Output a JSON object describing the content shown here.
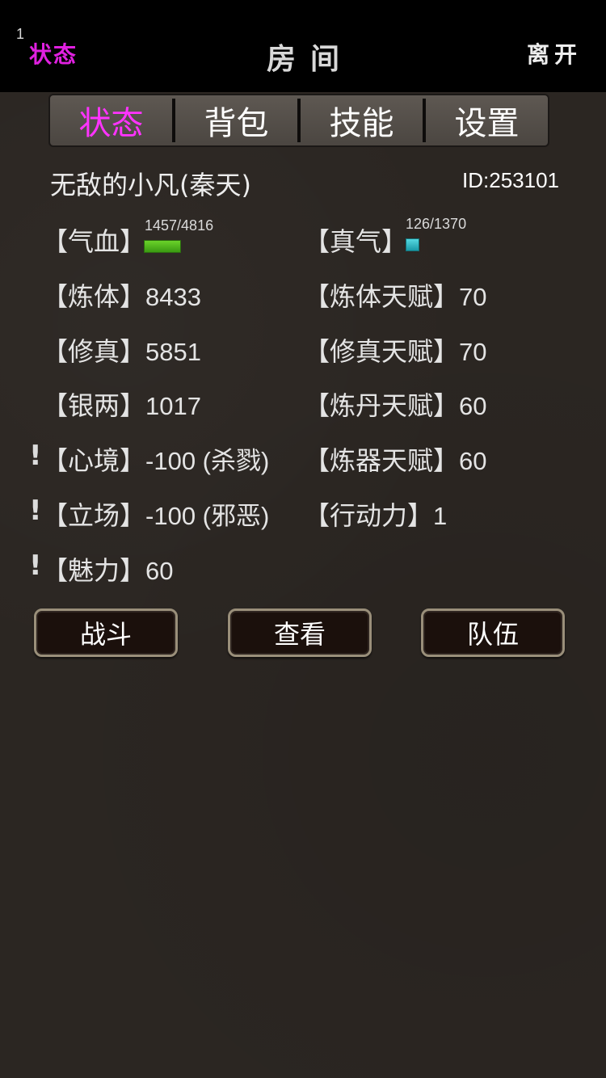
{
  "topbar": {
    "count": "1",
    "left_label": "状态",
    "title": "房间",
    "right_label": "离开",
    "left_label_color": "#e020e0"
  },
  "tabs": [
    {
      "label": "状态",
      "active": true
    },
    {
      "label": "背包",
      "active": false
    },
    {
      "label": "技能",
      "active": false
    },
    {
      "label": "设置",
      "active": false
    }
  ],
  "player": {
    "name": "无敌的小凡(秦天)",
    "id": "ID:253101"
  },
  "vitals": {
    "hp": {
      "label": "【气血】",
      "text": "1457/4816",
      "current": 1457,
      "max": 4816,
      "color": "#4fb81c"
    },
    "mp": {
      "label": "【真气】",
      "text": "126/1370",
      "current": 126,
      "max": 1370,
      "color": "#2bb8c4"
    }
  },
  "stats_left": [
    {
      "label": "【炼体】",
      "value": "8433",
      "warning": false
    },
    {
      "label": "【修真】",
      "value": "5851",
      "warning": false
    },
    {
      "label": "【银两】",
      "value": "1017",
      "warning": false
    },
    {
      "label": "【心境】",
      "value": "-100 (杀戮)",
      "warning": true
    },
    {
      "label": "【立场】",
      "value": "-100 (邪恶)",
      "warning": true
    },
    {
      "label": "【魅力】",
      "value": "60",
      "warning": true
    }
  ],
  "stats_right": [
    {
      "label": "【炼体天赋】",
      "value": "70"
    },
    {
      "label": "【修真天赋】",
      "value": "70"
    },
    {
      "label": "【炼丹天赋】",
      "value": "60"
    },
    {
      "label": "【炼器天赋】",
      "value": "60"
    },
    {
      "label": "【行动力】",
      "value": "1"
    }
  ],
  "warning_mark": "!",
  "buttons": {
    "fight": "战斗",
    "inspect": "查看",
    "team": "队伍"
  }
}
